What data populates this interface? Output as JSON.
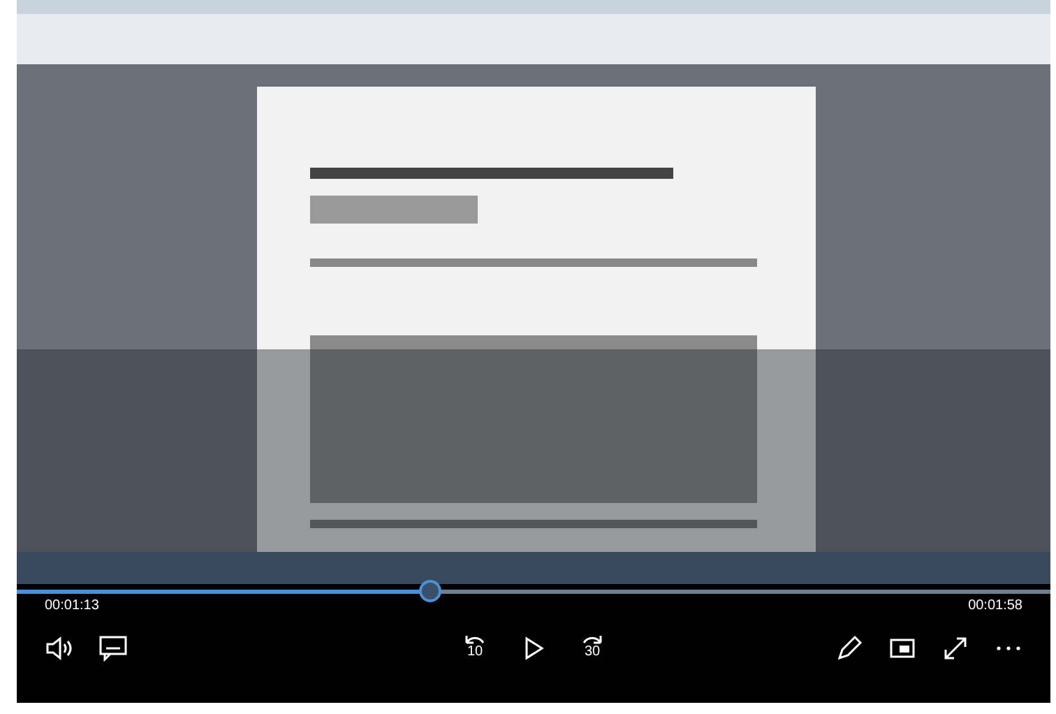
{
  "seek_bar": {
    "level": 0.4
  },
  "elapsed": "00:01:13",
  "duration": "00:01:58",
  "left_controls": [
    {
      "kind": "volume"
    },
    {
      "kind": "captions"
    }
  ],
  "center_controls": [
    {
      "kind": "skip-back",
      "label": "10"
    },
    {
      "kind": "play"
    },
    {
      "kind": "skip-forward",
      "label": "30"
    }
  ],
  "right_controls": [
    {
      "kind": "pen"
    },
    {
      "kind": "mini-view"
    },
    {
      "kind": "fullscreen"
    },
    {
      "kind": "more"
    }
  ]
}
